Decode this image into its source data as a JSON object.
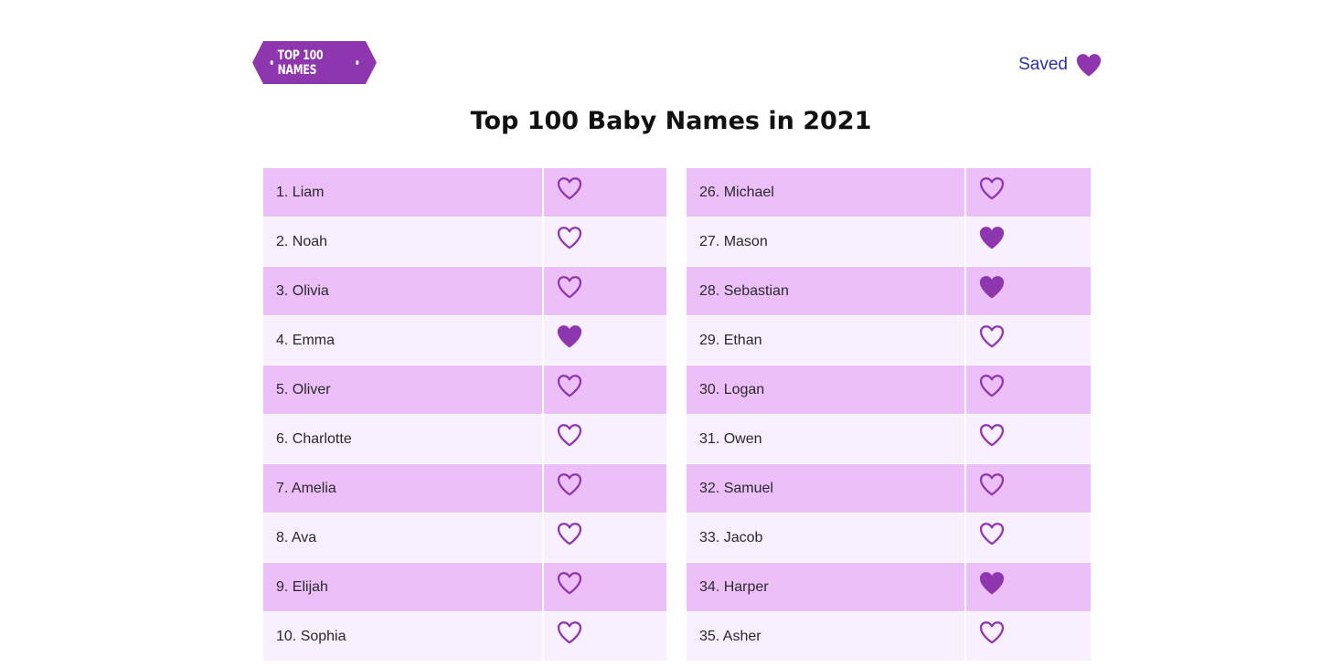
{
  "header": {
    "logo_text": "TOP 100 NAMES",
    "saved_label": "Saved"
  },
  "page_title": "Top 100 Baby Names in 2021",
  "colors": {
    "accent_purple": "#8e36ad",
    "row_dark": "#ecbff9",
    "row_light": "#f8efff",
    "link_blue": "#2f2fa8"
  },
  "icons": {
    "saved": "heart-filled-icon",
    "unsaved": "heart-outline-icon"
  },
  "left_column": [
    {
      "label": "1. Liam",
      "saved": false
    },
    {
      "label": "2. Noah",
      "saved": false
    },
    {
      "label": "3. Olivia",
      "saved": false
    },
    {
      "label": "4. Emma",
      "saved": true
    },
    {
      "label": "5. Oliver",
      "saved": false
    },
    {
      "label": "6. Charlotte",
      "saved": false
    },
    {
      "label": "7. Amelia",
      "saved": false
    },
    {
      "label": "8. Ava",
      "saved": false
    },
    {
      "label": "9. Elijah",
      "saved": false
    },
    {
      "label": "10. Sophia",
      "saved": false
    }
  ],
  "right_column": [
    {
      "label": "26. Michael",
      "saved": false
    },
    {
      "label": "27. Mason",
      "saved": true
    },
    {
      "label": "28. Sebastian",
      "saved": true
    },
    {
      "label": "29. Ethan",
      "saved": false
    },
    {
      "label": "30. Logan",
      "saved": false
    },
    {
      "label": "31. Owen",
      "saved": false
    },
    {
      "label": "32. Samuel",
      "saved": false
    },
    {
      "label": "33. Jacob",
      "saved": false
    },
    {
      "label": "34. Harper",
      "saved": true
    },
    {
      "label": "35. Asher",
      "saved": false
    }
  ]
}
